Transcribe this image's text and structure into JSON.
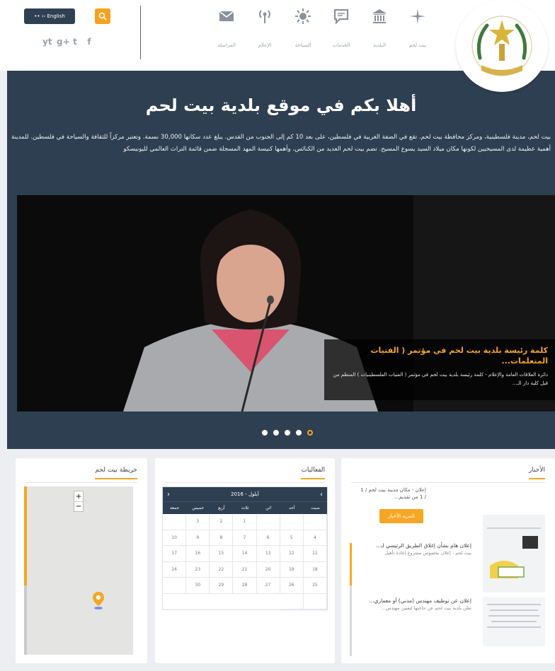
{
  "header": {
    "lang_label": "•• ›› English",
    "nav": [
      {
        "label": "بيت لحم",
        "icon": "star-icon"
      },
      {
        "label": "البلدية",
        "icon": "building-icon"
      },
      {
        "label": "الخدمات",
        "icon": "chat-icon"
      },
      {
        "label": "السياحة",
        "icon": "sun-icon"
      },
      {
        "label": "الإعلام",
        "icon": "broadcast-icon"
      },
      {
        "label": "المراسلة",
        "icon": "envelope-icon"
      }
    ],
    "social": [
      "f",
      "t",
      "g+",
      "yt"
    ]
  },
  "hero": {
    "title": "أهلا بكم في موقع بلدية بيت لحم",
    "description": "بيت لحم، مدينة فلسطينية، ومركز محافظة بيت لحم. تقع في الضفة الغربية في فلسطين، على بعد 10 كم إلى الجنوب من القدس. يبلغ عدد سكانها 30,000 نسمة. وتعتبر مركزاً للثقافة والسياحة في فلسطين. للمدينة أهمية عظيمة لدى المسيحيين لكونها مكان ميلاد السيد يسوع المسيح. تضم بيت لحم العديد من الكنائس، وأهمها كنيسة المهد المسجلة ضمن قائمة التراث العالمي لليونيسكو",
    "caption_title": "كلمة رئيسة بلدية بيت لحم في مؤتمر ( الفتيات المتعلمات...",
    "caption_text": "دائرة العلاقات العامة والإعلام - كلمة رئيسة بلدية بيت لحم في مؤتمر ( الفتيات الفلسطينيات ) المنظم من قبل كلية دار الـ...",
    "dots": 5,
    "active_dot": 5
  },
  "news": {
    "title": "الأخبار",
    "item1": "إعلان - مكان مدينة بيت لحم / 1 / 1 من تقديم...",
    "more_label": "المزيد الأخبار",
    "entry1_title": "إعلان هام بشأن إغلاق الطريق الرئيسي لـ...",
    "entry1_sub": "بيت لحم - إعلان بخصوص مشروع إعادة تأهيل",
    "entry2_title": "إعلان عن توظيف مهندس (مدني) أو معماري...",
    "entry2_sub": "تعلن بلدية بيت لحم عن حاجتها لتعيين مهندس..."
  },
  "events": {
    "title": "الفعاليات",
    "month": "أيلول - 2016",
    "days": [
      "سبت",
      "أحد",
      "اثن",
      "ثلاث",
      "أربع",
      "خميس",
      "جمعة"
    ],
    "dates": [
      "",
      "",
      "",
      "1",
      "2",
      "3",
      "",
      "4",
      "5",
      "6",
      "7",
      "8",
      "9",
      "10",
      "11",
      "12",
      "13",
      "14",
      "15",
      "16",
      "17",
      "18",
      "19",
      "20",
      "21",
      "22",
      "23",
      "24",
      "25",
      "26",
      "27",
      "28",
      "29",
      "30",
      "",
      "",
      ""
    ]
  },
  "map": {
    "title": "خريطة بيت لحم"
  }
}
